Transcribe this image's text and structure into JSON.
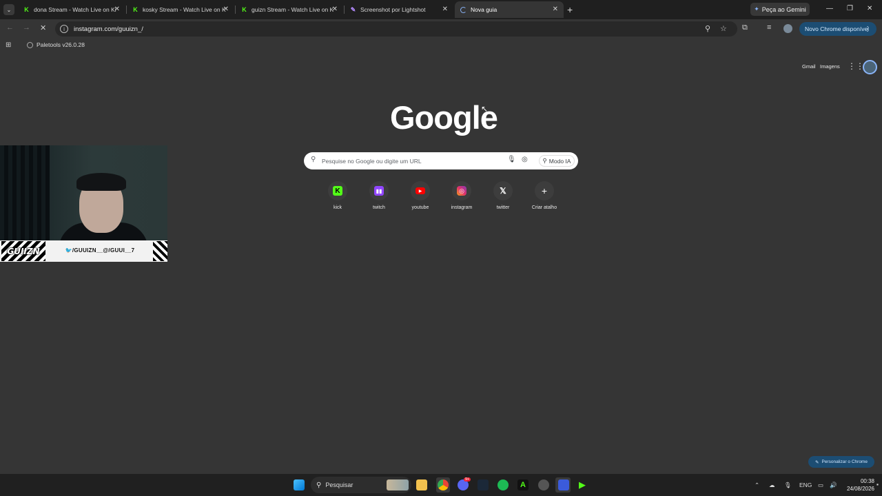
{
  "tabs": [
    {
      "title": "dona Stream - Watch Live on Ki",
      "icon": "kick-icon",
      "active": false
    },
    {
      "title": "kosky Stream - Watch Live on K",
      "icon": "kick-icon",
      "active": false
    },
    {
      "title": "guizn Stream - Watch Live on K",
      "icon": "kick-icon",
      "active": false
    },
    {
      "title": "Screenshot por Lightshot",
      "icon": "lightshot-icon",
      "active": false
    },
    {
      "title": "Nova guia",
      "icon": "loading-icon",
      "active": true
    }
  ],
  "gemini_label": "Peça ao Gemini",
  "address_bar": {
    "url": "instagram.com/guuizn_/"
  },
  "update_button": "Novo Chrome disponível",
  "bookmarks": [
    {
      "label": "Paletools v26.0.28"
    }
  ],
  "ntp": {
    "top_links": {
      "gmail": "Gmail",
      "images": "Imagens"
    },
    "logo": "Google",
    "search_placeholder": "Pesquise no Google ou digite um URL",
    "ai_mode": "Modo IA",
    "shortcuts": [
      {
        "label": "kick",
        "icon": "kick-icon"
      },
      {
        "label": "twitch",
        "icon": "twitch-icon"
      },
      {
        "label": "youtube",
        "icon": "youtube-icon"
      },
      {
        "label": "instagram",
        "icon": "instagram-icon"
      },
      {
        "label": "twitter",
        "icon": "x-icon"
      },
      {
        "label": "Criar atalho",
        "icon": "plus-icon"
      }
    ],
    "customize": "Personalizar o Chrome"
  },
  "webcam": {
    "logo": "GUIIZN",
    "caption": "🐦/GUUIZN__@/GUUI__7"
  },
  "taskbar": {
    "search": "Pesquisar",
    "language": "ENG",
    "time": "00:38",
    "date": "24/08/2026",
    "discord_badge": "9+"
  },
  "colors": {
    "page_bg": "#353535",
    "tabstrip_bg": "#1f1f1f",
    "accent_blue": "#1c4d73",
    "kick_green": "#53fc18"
  }
}
